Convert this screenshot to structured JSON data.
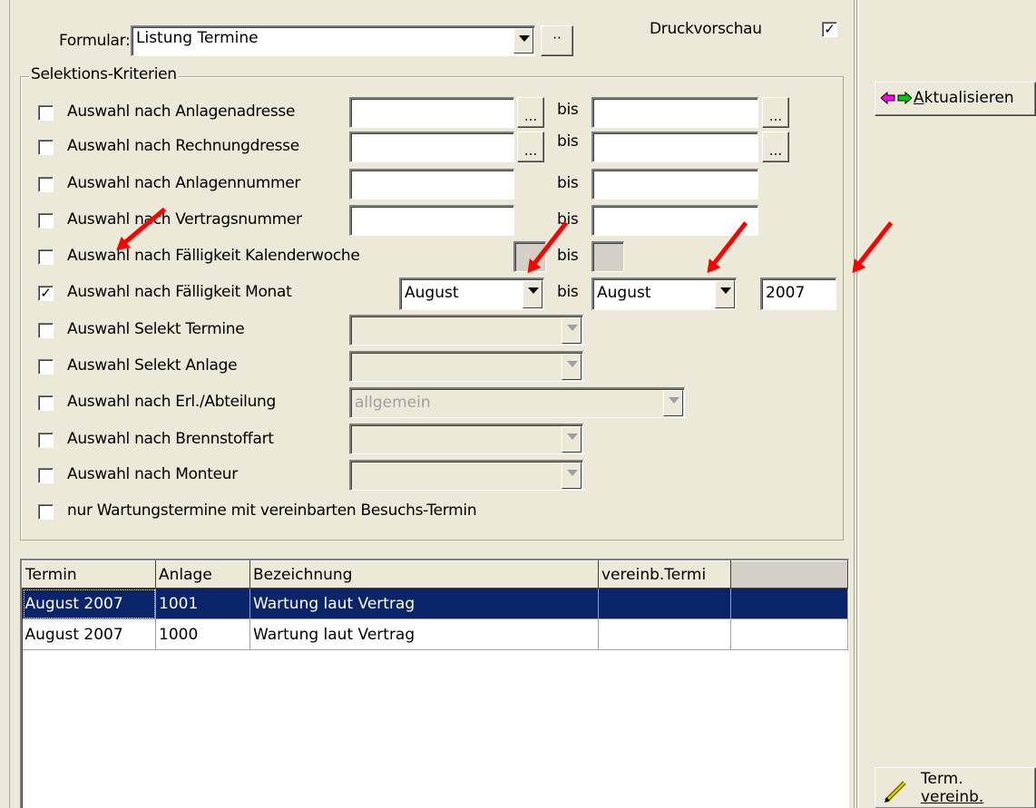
{
  "form": {
    "label": "Formular:",
    "value": "Listung Termine",
    "browse": "··"
  },
  "preview": {
    "label": "Druckvorschau",
    "checked": "✓"
  },
  "group": {
    "title": "Selektions-Kriterien"
  },
  "criteria": [
    {
      "label": "Auswahl nach Anlagenadresse",
      "checked": ""
    },
    {
      "label": "Auswahl nach Rechnungdresse",
      "checked": ""
    },
    {
      "label": "Auswahl nach Anlagennummer",
      "checked": ""
    },
    {
      "label": "Auswahl nach Vertragsnummer",
      "checked": ""
    },
    {
      "label": "Auswahl nach Fälligkeit Kalenderwoche",
      "checked": ""
    },
    {
      "label": "Auswahl nach Fälligkeit Monat",
      "checked": "✓"
    },
    {
      "label": "Auswahl Selekt Termine",
      "checked": ""
    },
    {
      "label": "Auswahl Selekt Anlage",
      "checked": ""
    },
    {
      "label": "Auswahl nach Erl./Abteilung",
      "checked": ""
    },
    {
      "label": "Auswahl nach Brennstoffart",
      "checked": ""
    },
    {
      "label": "Auswahl nach Monteur",
      "checked": ""
    },
    {
      "label": "nur Wartungstermine mit vereinbarten Besuchs-Termin",
      "checked": ""
    }
  ],
  "bis": "bis",
  "ellipsis": "...",
  "month_from": "August",
  "month_to": "August",
  "year": "2007",
  "department": "allgemein",
  "table": {
    "columns": [
      "Termin",
      "Anlage",
      "Bezeichnung",
      "vereinb.Termi",
      ""
    ],
    "rows": [
      [
        "August  2007",
        "1001",
        "Wartung laut Vertrag",
        "",
        ""
      ],
      [
        "August  2007",
        "1000",
        "Wartung laut Vertrag",
        "",
        ""
      ]
    ]
  },
  "buttons": {
    "refresh": "Aktualisieren",
    "refresh_u": "A",
    "term_line1": "Term.",
    "term_line2": "vereinb."
  },
  "colors": {
    "selection": "#0a246a",
    "annotation_arrow": "#ff0000"
  }
}
